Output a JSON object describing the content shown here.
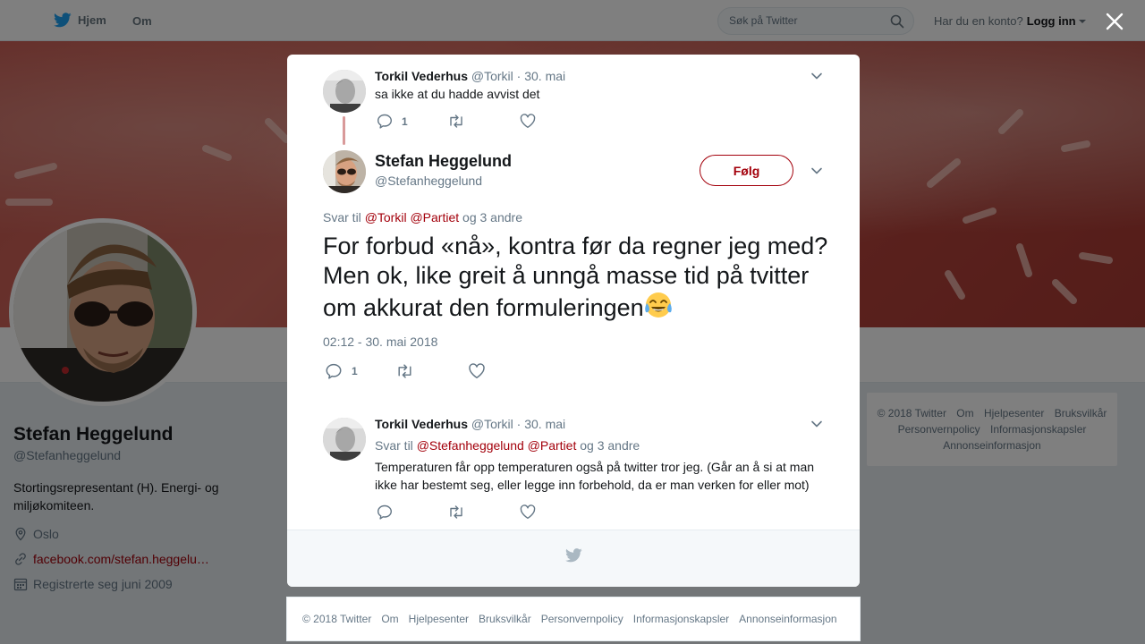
{
  "topbar": {
    "home_label": "Hjem",
    "about_label": "Om",
    "search_placeholder": "Søk på Twitter",
    "login_prompt": "Har du en konto?",
    "login_label": "Logg inn"
  },
  "profile": {
    "name": "Stefan Heggelund",
    "handle": "@Stefanheggelund",
    "bio": "Stortingsrepresentant (H). Energi- og miljøkomiteen.",
    "location": "Oslo",
    "website": "facebook.com/stefan.heggelu…",
    "joined": "Registrerte seg juni 2009"
  },
  "side_footer": {
    "line1": [
      "© 2018 Twitter",
      "Om",
      "Hjelpesenter",
      "Bruksvilkår"
    ],
    "line2": [
      "Personvernpolicy",
      "Informasjonskapsler"
    ],
    "line3": [
      "Annonseinformasjon"
    ]
  },
  "thread": {
    "parent": {
      "name": "Torkil Vederhus",
      "handle": "@Torkil",
      "date": "· 30. mai",
      "text": "sa ikke at du hadde avvist det",
      "reply_count": "1"
    },
    "main": {
      "name": "Stefan Heggelund",
      "handle": "@Stefanheggelund",
      "follow_label": "Følg",
      "reply_prefix": "Svar til",
      "mention1": "@Torkil",
      "mention2": "@Partiet",
      "reply_suffix": "og 3 andre",
      "text": "For forbud «nå», kontra før da regner jeg med? Men ok, like greit å unngå masse tid på tvitter om akkurat den formuleringen",
      "emoji": "face-with-tears-of-joy",
      "timestamp": "02:12 - 30. mai 2018",
      "reply_count": "1"
    },
    "reply": {
      "name": "Torkil Vederhus",
      "handle": "@Torkil",
      "date": "· 30. mai",
      "reply_prefix": "Svar til",
      "mention1": "@Stefanheggelund",
      "mention2": "@Partiet",
      "reply_suffix": "og 3 andre",
      "text": "Temperaturen får opp temperaturen også på twitter tror jeg. (Går an å si at man ikke har bestemt seg, eller legge inn forbehold, da er man verken for eller mot)"
    }
  },
  "bottom_footer": [
    "© 2018 Twitter",
    "Om",
    "Hjelpesenter",
    "Bruksvilkår",
    "Personvernpolicy",
    "Informasjonskapsler",
    "Annonseinformasjon"
  ],
  "colors": {
    "accent": "#a3000b",
    "twitter_blue": "#1da1f2",
    "muted": "#657786"
  },
  "icons": [
    "twitter-bird-icon",
    "search-icon",
    "close-icon",
    "chevron-down-icon",
    "reply-icon",
    "retweet-icon",
    "like-icon",
    "location-icon",
    "link-icon",
    "calendar-icon"
  ]
}
